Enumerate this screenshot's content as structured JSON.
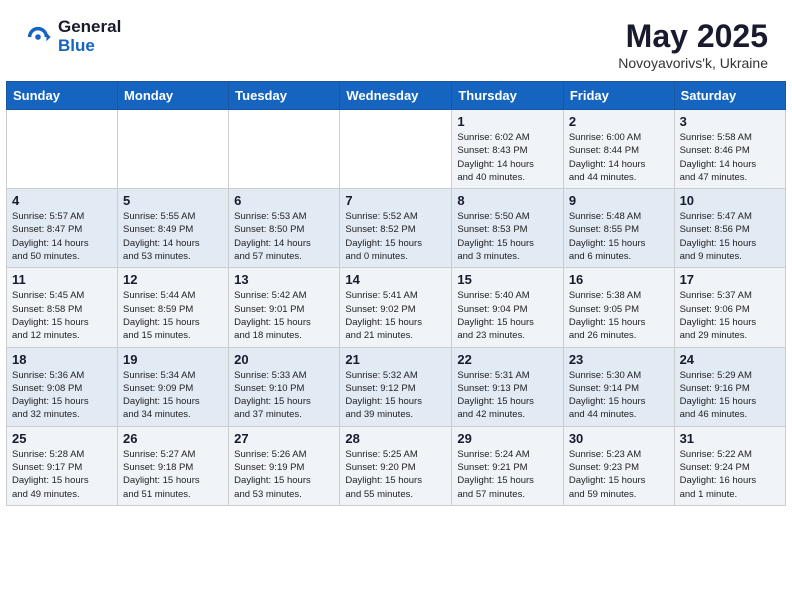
{
  "header": {
    "logo_general": "General",
    "logo_blue": "Blue",
    "month_title": "May 2025",
    "subtitle": "Novoyavorivs'k, Ukraine"
  },
  "days_of_week": [
    "Sunday",
    "Monday",
    "Tuesday",
    "Wednesday",
    "Thursday",
    "Friday",
    "Saturday"
  ],
  "weeks": [
    [
      {
        "day": "",
        "info": ""
      },
      {
        "day": "",
        "info": ""
      },
      {
        "day": "",
        "info": ""
      },
      {
        "day": "",
        "info": ""
      },
      {
        "day": "1",
        "info": "Sunrise: 6:02 AM\nSunset: 8:43 PM\nDaylight: 14 hours\nand 40 minutes."
      },
      {
        "day": "2",
        "info": "Sunrise: 6:00 AM\nSunset: 8:44 PM\nDaylight: 14 hours\nand 44 minutes."
      },
      {
        "day": "3",
        "info": "Sunrise: 5:58 AM\nSunset: 8:46 PM\nDaylight: 14 hours\nand 47 minutes."
      }
    ],
    [
      {
        "day": "4",
        "info": "Sunrise: 5:57 AM\nSunset: 8:47 PM\nDaylight: 14 hours\nand 50 minutes."
      },
      {
        "day": "5",
        "info": "Sunrise: 5:55 AM\nSunset: 8:49 PM\nDaylight: 14 hours\nand 53 minutes."
      },
      {
        "day": "6",
        "info": "Sunrise: 5:53 AM\nSunset: 8:50 PM\nDaylight: 14 hours\nand 57 minutes."
      },
      {
        "day": "7",
        "info": "Sunrise: 5:52 AM\nSunset: 8:52 PM\nDaylight: 15 hours\nand 0 minutes."
      },
      {
        "day": "8",
        "info": "Sunrise: 5:50 AM\nSunset: 8:53 PM\nDaylight: 15 hours\nand 3 minutes."
      },
      {
        "day": "9",
        "info": "Sunrise: 5:48 AM\nSunset: 8:55 PM\nDaylight: 15 hours\nand 6 minutes."
      },
      {
        "day": "10",
        "info": "Sunrise: 5:47 AM\nSunset: 8:56 PM\nDaylight: 15 hours\nand 9 minutes."
      }
    ],
    [
      {
        "day": "11",
        "info": "Sunrise: 5:45 AM\nSunset: 8:58 PM\nDaylight: 15 hours\nand 12 minutes."
      },
      {
        "day": "12",
        "info": "Sunrise: 5:44 AM\nSunset: 8:59 PM\nDaylight: 15 hours\nand 15 minutes."
      },
      {
        "day": "13",
        "info": "Sunrise: 5:42 AM\nSunset: 9:01 PM\nDaylight: 15 hours\nand 18 minutes."
      },
      {
        "day": "14",
        "info": "Sunrise: 5:41 AM\nSunset: 9:02 PM\nDaylight: 15 hours\nand 21 minutes."
      },
      {
        "day": "15",
        "info": "Sunrise: 5:40 AM\nSunset: 9:04 PM\nDaylight: 15 hours\nand 23 minutes."
      },
      {
        "day": "16",
        "info": "Sunrise: 5:38 AM\nSunset: 9:05 PM\nDaylight: 15 hours\nand 26 minutes."
      },
      {
        "day": "17",
        "info": "Sunrise: 5:37 AM\nSunset: 9:06 PM\nDaylight: 15 hours\nand 29 minutes."
      }
    ],
    [
      {
        "day": "18",
        "info": "Sunrise: 5:36 AM\nSunset: 9:08 PM\nDaylight: 15 hours\nand 32 minutes."
      },
      {
        "day": "19",
        "info": "Sunrise: 5:34 AM\nSunset: 9:09 PM\nDaylight: 15 hours\nand 34 minutes."
      },
      {
        "day": "20",
        "info": "Sunrise: 5:33 AM\nSunset: 9:10 PM\nDaylight: 15 hours\nand 37 minutes."
      },
      {
        "day": "21",
        "info": "Sunrise: 5:32 AM\nSunset: 9:12 PM\nDaylight: 15 hours\nand 39 minutes."
      },
      {
        "day": "22",
        "info": "Sunrise: 5:31 AM\nSunset: 9:13 PM\nDaylight: 15 hours\nand 42 minutes."
      },
      {
        "day": "23",
        "info": "Sunrise: 5:30 AM\nSunset: 9:14 PM\nDaylight: 15 hours\nand 44 minutes."
      },
      {
        "day": "24",
        "info": "Sunrise: 5:29 AM\nSunset: 9:16 PM\nDaylight: 15 hours\nand 46 minutes."
      }
    ],
    [
      {
        "day": "25",
        "info": "Sunrise: 5:28 AM\nSunset: 9:17 PM\nDaylight: 15 hours\nand 49 minutes."
      },
      {
        "day": "26",
        "info": "Sunrise: 5:27 AM\nSunset: 9:18 PM\nDaylight: 15 hours\nand 51 minutes."
      },
      {
        "day": "27",
        "info": "Sunrise: 5:26 AM\nSunset: 9:19 PM\nDaylight: 15 hours\nand 53 minutes."
      },
      {
        "day": "28",
        "info": "Sunrise: 5:25 AM\nSunset: 9:20 PM\nDaylight: 15 hours\nand 55 minutes."
      },
      {
        "day": "29",
        "info": "Sunrise: 5:24 AM\nSunset: 9:21 PM\nDaylight: 15 hours\nand 57 minutes."
      },
      {
        "day": "30",
        "info": "Sunrise: 5:23 AM\nSunset: 9:23 PM\nDaylight: 15 hours\nand 59 minutes."
      },
      {
        "day": "31",
        "info": "Sunrise: 5:22 AM\nSunset: 9:24 PM\nDaylight: 16 hours\nand 1 minute."
      }
    ]
  ]
}
